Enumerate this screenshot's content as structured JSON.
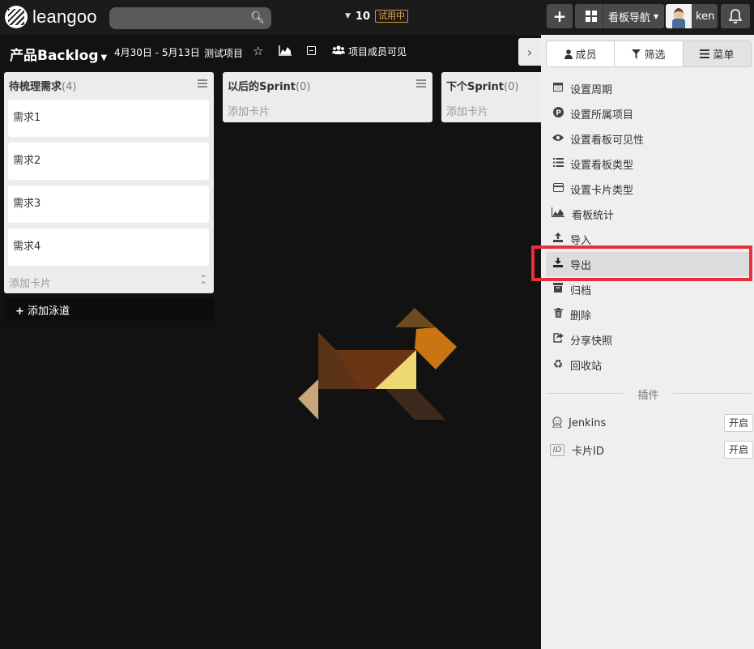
{
  "topbar": {
    "logo_text": "leangoo",
    "search_placeholder": "",
    "counter_value": "10",
    "trial_badge": "试用中",
    "nav_label": "看板导航",
    "user_name": "ken"
  },
  "board": {
    "title": "产品Backlog",
    "date_range": "4月30日 - 5月13日",
    "project": "测试项目",
    "visibility": "项目成员可见"
  },
  "lists": [
    {
      "title": "待梳理需求",
      "count": "(4)",
      "cards": [
        "需求1",
        "需求2",
        "需求3",
        "需求4"
      ],
      "add_card": "添加卡片"
    },
    {
      "title": "以后的Sprint",
      "count": "(0)",
      "add_card": "添加卡片"
    },
    {
      "title": "下个Sprint",
      "count": "(0)",
      "add_card": "添加卡片"
    }
  ],
  "add_lane": "添加泳道",
  "sidebar": {
    "tabs": [
      {
        "label": "成员",
        "icon": "user-icon"
      },
      {
        "label": "筛选",
        "icon": "filter-icon"
      },
      {
        "label": "菜单",
        "icon": "bars-icon"
      }
    ],
    "active_tab": "菜单",
    "menu_items": [
      {
        "label": "设置周期",
        "icon": "calendar-icon"
      },
      {
        "label": "设置所属项目",
        "icon": "p-circle-icon"
      },
      {
        "label": "设置看板可见性",
        "icon": "eye-icon"
      },
      {
        "label": "设置看板类型",
        "icon": "list-icon"
      },
      {
        "label": "设置卡片类型",
        "icon": "card-icon"
      },
      {
        "label": "看板统计",
        "icon": "area-chart-icon"
      },
      {
        "label": "导入",
        "icon": "upload-icon"
      },
      {
        "label": "导出",
        "icon": "download-icon"
      },
      {
        "label": "归档",
        "icon": "archive-icon"
      },
      {
        "label": "删除",
        "icon": "trash-icon"
      },
      {
        "label": "分享快照",
        "icon": "share-icon"
      },
      {
        "label": "回收站",
        "icon": "recycle-icon"
      }
    ],
    "highlighted_item": "导出",
    "plugins_section": "插件",
    "plugins": [
      {
        "label": "Jenkins",
        "icon": "jenkins-icon",
        "action": "开启"
      },
      {
        "label": "卡片ID",
        "icon": "id-icon",
        "icon_text": "ID",
        "action": "开启"
      }
    ]
  },
  "colors": {
    "background": "#121212",
    "highlight_border": "#e8303a",
    "trial_badge": "#e3a04c"
  }
}
